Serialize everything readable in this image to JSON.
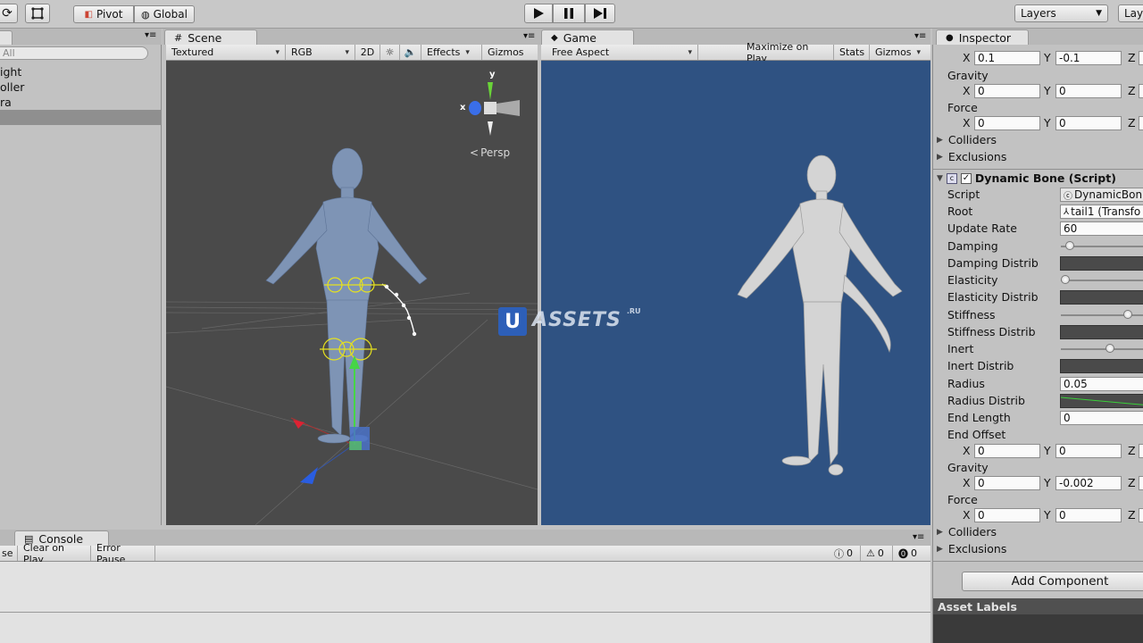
{
  "toolbar": {
    "pivot_label": "Pivot",
    "global_label": "Global",
    "layers_label": "Layers",
    "layout_label": "Lay"
  },
  "hierarchy": {
    "search_placeholder": "All",
    "items": [
      "ight",
      "oller",
      "ra",
      ""
    ]
  },
  "scene": {
    "tab_label": "Scene",
    "shading": "Textured",
    "color_mode": "RGB",
    "mode_2d": "2D",
    "effects": "Effects",
    "gizmos": "Gizmos",
    "persp_label": "Persp",
    "gizmo_y": "y",
    "gizmo_x": "x"
  },
  "game": {
    "tab_label": "Game",
    "aspect": "Free Aspect",
    "maximize": "Maximize on Play",
    "stats": "Stats",
    "gizmos": "Gizmos"
  },
  "watermark": {
    "u": "U",
    "text": "ASSETS",
    "suffix": ".RU"
  },
  "console": {
    "tab_label": "Console",
    "clear_partial": "se",
    "clear_on_play": "Clear on Play",
    "error_pause": "Error Pause",
    "info_count": "0",
    "warn_count": "0",
    "error_count": "0"
  },
  "inspector": {
    "tab_label": "Inspector",
    "top_x": "0.1",
    "top_y": "-0.1",
    "gravity_label": "Gravity",
    "gravity_x": "0",
    "gravity_y": "0",
    "force_label": "Force",
    "force_x": "0",
    "force_y": "0",
    "colliders_label": "Colliders",
    "exclusions_label": "Exclusions",
    "component_title": "Dynamic Bone (Script)",
    "rows": {
      "script": "Script",
      "script_value": "DynamicBon",
      "root": "Root",
      "root_value": "tail1 (Transfo",
      "update_rate": "Update Rate",
      "update_rate_value": "60",
      "damping": "Damping",
      "damping_distrib": "Damping Distrib",
      "elasticity": "Elasticity",
      "elasticity_distrib": "Elasticity Distrib",
      "stiffness": "Stiffness",
      "stiffness_distrib": "Stiffness Distrib",
      "inert": "Inert",
      "inert_distrib": "Inert Distrib",
      "radius": "Radius",
      "radius_value": "0.05",
      "radius_distrib": "Radius Distrib",
      "end_length": "End Length",
      "end_length_value": "0",
      "end_offset": "End Offset",
      "end_offset_x": "0",
      "end_offset_y": "0",
      "gravity2": "Gravity",
      "gravity2_x": "0",
      "gravity2_y": "-0.002",
      "force2": "Force",
      "force2_x": "0",
      "force2_y": "0",
      "colliders2": "Colliders",
      "exclusions2": "Exclusions"
    },
    "sliders": {
      "damping": 0.1,
      "elasticity": 0.05,
      "stiffness": 0.75,
      "inert": 0.55
    },
    "axis_x": "X",
    "axis_y": "Y",
    "axis_z": "Z",
    "add_component": "Add Component",
    "asset_labels": "Asset Labels"
  },
  "colors": {
    "scene_bg": "#4a4a4a",
    "game_bg": "#2f5282",
    "model_scene": "#7e94b5",
    "model_game": "#d4d4d4",
    "gizmo_yellow": "#e6e21e"
  }
}
